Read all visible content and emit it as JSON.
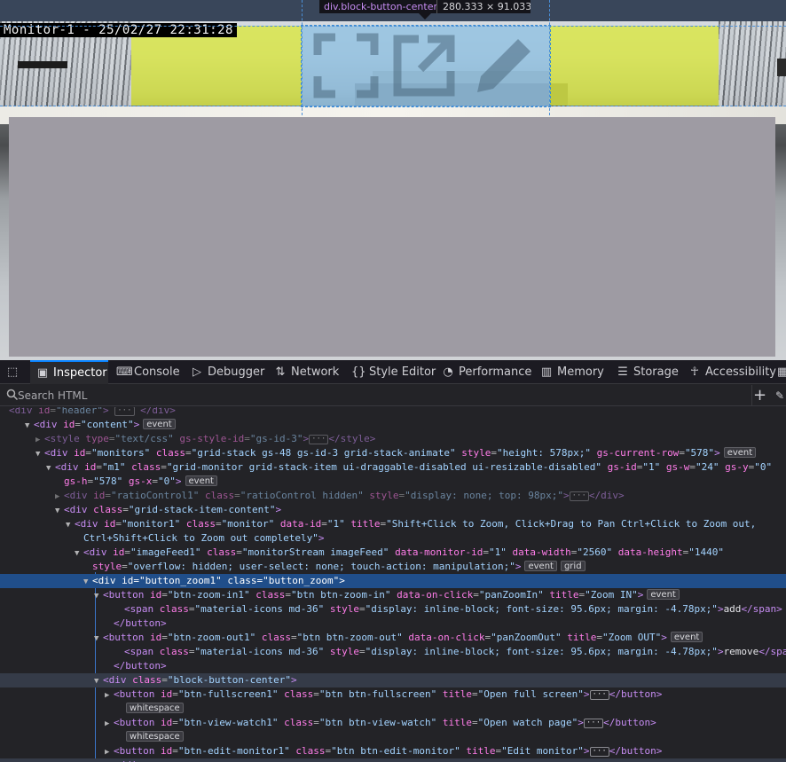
{
  "page": {
    "timestamp": "Monitor-1 - 25/02/27 22:31:28"
  },
  "tooltip": {
    "tag": "div",
    "cls": ".block-button-center",
    "dims": "280.333 × 91.0333"
  },
  "tabs": {
    "inspector": "Inspector",
    "console": "Console",
    "debugger": "Debugger",
    "network": "Network",
    "style_editor": "Style Editor",
    "performance": "Performance",
    "memory": "Memory",
    "storage": "Storage",
    "accessibility": "Accessibility"
  },
  "search": {
    "placeholder": "Search HTML"
  },
  "markup": [
    {
      "indent": 5,
      "tw": "",
      "html": "<span class='tg'>&lt;div</span> <span class='an'>id</span>=<span class='av'>\"header\"</span><span class='tg'>&gt;</span> <span class='ell'>···</span> <span class='tg'>&lt;/div&gt;</span>",
      "cls": "dim"
    },
    {
      "indent": 38,
      "tw": "▼",
      "html": "<span class='tg'>&lt;div</span> <span class='an'>id</span>=<span class='av'>\"content\"</span><span class='tg'>&gt;</span><span class='badge'>event</span>"
    },
    {
      "indent": 50,
      "tw": "▶",
      "html": "<span class='tg'>&lt;style</span> <span class='an'>type</span>=<span class='av'>\"text/css\"</span> <span class='an'>gs-style-id</span>=<span class='av'>\"gs-id-3\"</span><span class='tg'>&gt;</span><span class='ell'>···</span><span class='tg'>&lt;/style&gt;</span>",
      "cls": "dim"
    },
    {
      "indent": 50,
      "tw": "▼",
      "html": "<span class='tg'>&lt;div</span> <span class='an'>id</span>=<span class='av'>\"monitors\"</span> <span class='an'>class</span>=<span class='av'>\"grid-stack gs-48 gs-id-3 grid-stack-animate\"</span> <span class='an'>style</span>=<span class='av'>\"height: 578px;\"</span> <span class='an'>gs-current-row</span>=<span class='av'>\"578\"</span><span class='tg'>&gt;</span><span class='badge'>event</span>"
    },
    {
      "indent": 62,
      "tw": "▼",
      "html": "<span class='tg'>&lt;div</span> <span class='an'>id</span>=<span class='av'>\"m1\"</span> <span class='an'>class</span>=<span class='av'>\"grid-monitor grid-stack-item ui-draggable-disabled ui-resizable-disabled\"</span> <span class='an'>gs-id</span>=<span class='av'>\"1\"</span> <span class='an'>gs-w</span>=<span class='av'>\"24\"</span> <span class='an'>gs-y</span>=<span class='av'>\"0\"</span>"
    },
    {
      "indent": 72,
      "tw": "",
      "html": "<span class='an'>gs-h</span>=<span class='av'>\"578\"</span> <span class='an'>gs-x</span>=<span class='av'>\"0\"</span><span class='tg'>&gt;</span><span class='badge'>event</span>"
    },
    {
      "indent": 72,
      "tw": "▶",
      "html": "<span class='tg'>&lt;div</span> <span class='an'>id</span>=<span class='av'>\"ratioControl1\"</span> <span class='an'>class</span>=<span class='av'>\"ratioControl hidden\"</span> <span class='an'>style</span>=<span class='av'>\"display: none; top: 98px;\"</span><span class='tg'>&gt;</span><span class='ell'>···</span><span class='tg'>&lt;/div&gt;</span>",
      "cls": "dim"
    },
    {
      "indent": 72,
      "tw": "▼",
      "html": "<span class='tg'>&lt;div</span> <span class='an'>class</span>=<span class='av'>\"grid-stack-item-content\"</span><span class='tg'>&gt;</span>"
    },
    {
      "indent": 84,
      "tw": "▼",
      "html": "<span class='tg'>&lt;div</span> <span class='an'>id</span>=<span class='av'>\"monitor1\"</span> <span class='an'>class</span>=<span class='av'>\"monitor\"</span> <span class='an'>data-id</span>=<span class='av'>\"1\"</span> <span class='an'>title</span>=<span class='av'>\"Shift+Click to Zoom, Click+Drag to Pan Ctrl+Click to Zoom out,</span>"
    },
    {
      "indent": 94,
      "tw": "",
      "html": "<span class='av'>Ctrl+Shift+Click to Zoom out completely\"</span><span class='tg'>&gt;</span>"
    },
    {
      "indent": 94,
      "tw": "▼",
      "html": "<span class='tg'>&lt;div</span> <span class='an'>id</span>=<span class='av'>\"imageFeed1\"</span> <span class='an'>class</span>=<span class='av'>\"monitorStream imageFeed\"</span> <span class='an'>data-monitor-id</span>=<span class='av'>\"1\"</span> <span class='an'>data-width</span>=<span class='av'>\"2560\"</span> <span class='an'>data-height</span>=<span class='av'>\"1440\"</span>"
    },
    {
      "indent": 104,
      "tw": "",
      "html": "<span class='an'>style</span>=<span class='av'>\"overflow: hidden; user-select: none; touch-action: manipulation;\"</span><span class='tg'>&gt;</span><span class='badge'>event</span><span class='badge'>grid</span>"
    },
    {
      "indent": 104,
      "tw": "▼",
      "html": "<span class='tg'>&lt;div</span> <span class='an'>id</span>=<span class='av'>\"button_zoom1\"</span> <span class='an'>class</span>=<span class='av'>\"button_zoom\"</span><span class='tg'>&gt;</span>",
      "cls": "hl"
    },
    {
      "indent": 116,
      "tw": "▼",
      "html": "<span class='tg'>&lt;button</span> <span class='an'>id</span>=<span class='av'>\"btn-zoom-in1\"</span> <span class='an'>class</span>=<span class='av'>\"btn btn-zoom-in\"</span> <span class='an'>data-on-click</span>=<span class='av'>\"panZoomIn\"</span> <span class='an'>title</span>=<span class='av'>\"Zoom IN\"</span><span class='tg'>&gt;</span><span class='badge'>event</span>"
    },
    {
      "indent": 140,
      "tw": "",
      "html": "<span class='tg'>&lt;span</span> <span class='an'>class</span>=<span class='av'>\"material-icons md-36\"</span> <span class='an'>style</span>=<span class='av'>\"display: inline-block; font-size: 95.6px; margin: -4.78px;\"</span><span class='tg'>&gt;</span><span class='tx'>add</span><span class='tg'>&lt;/span&gt;</span>"
    },
    {
      "indent": 128,
      "tw": "",
      "html": "<span class='tg'>&lt;/button&gt;</span>"
    },
    {
      "indent": 116,
      "tw": "▼",
      "html": "<span class='tg'>&lt;button</span> <span class='an'>id</span>=<span class='av'>\"btn-zoom-out1\"</span> <span class='an'>class</span>=<span class='av'>\"btn btn-zoom-out\"</span> <span class='an'>data-on-click</span>=<span class='av'>\"panZoomOut\"</span> <span class='an'>title</span>=<span class='av'>\"Zoom OUT\"</span><span class='tg'>&gt;</span><span class='badge'>event</span>"
    },
    {
      "indent": 140,
      "tw": "",
      "html": "<span class='tg'>&lt;span</span> <span class='an'>class</span>=<span class='av'>\"material-icons md-36\"</span> <span class='an'>style</span>=<span class='av'>\"display: inline-block; font-size: 95.6px; margin: -4.78px;\"</span><span class='tg'>&gt;</span><span class='tx'>remove</span><span class='tg'>&lt;/span&gt;</span>"
    },
    {
      "indent": 128,
      "tw": "",
      "html": "<span class='tg'>&lt;/button&gt;</span>"
    },
    {
      "indent": 116,
      "tw": "▼",
      "html": "<span class='tg'>&lt;div</span> <span class='an'>class</span>=<span class='av'>\"block-button-center\"</span><span class='tg'>&gt;</span>",
      "cls": "hover"
    },
    {
      "indent": 128,
      "tw": "▶",
      "html": "<span class='tg'>&lt;button</span> <span class='an'>id</span>=<span class='av'>\"btn-fullscreen1\"</span> <span class='an'>class</span>=<span class='av'>\"btn btn-fullscreen\"</span> <span class='an'>title</span>=<span class='av'>\"Open full screen\"</span><span class='tg'>&gt;</span><span class='ell'>···</span><span class='tg'>&lt;/button&gt;</span>"
    },
    {
      "indent": 138,
      "tw": "",
      "html": "<span class='badge'>whitespace</span>"
    },
    {
      "indent": 128,
      "tw": "▶",
      "html": "<span class='tg'>&lt;button</span> <span class='an'>id</span>=<span class='av'>\"btn-view-watch1\"</span> <span class='an'>class</span>=<span class='av'>\"btn btn-view-watch\"</span> <span class='an'>title</span>=<span class='av'>\"Open watch page\"</span><span class='tg'>&gt;</span><span class='ell'>···</span><span class='tg'>&lt;/button&gt;</span>"
    },
    {
      "indent": 138,
      "tw": "",
      "html": "<span class='badge'>whitespace</span>"
    },
    {
      "indent": 128,
      "tw": "▶",
      "html": "<span class='tg'>&lt;button</span> <span class='an'>id</span>=<span class='av'>\"btn-edit-monitor1\"</span> <span class='an'>class</span>=<span class='av'>\"btn btn-edit-monitor\"</span> <span class='an'>title</span>=<span class='av'>\"Edit monitor\"</span><span class='tg'>&gt;</span><span class='ell'>···</span><span class='tg'>&lt;/button&gt;</span>"
    },
    {
      "indent": 128,
      "tw": "",
      "html": "<span class='tg'>&lt;/div&gt;</span>",
      "cls": "hover"
    }
  ]
}
